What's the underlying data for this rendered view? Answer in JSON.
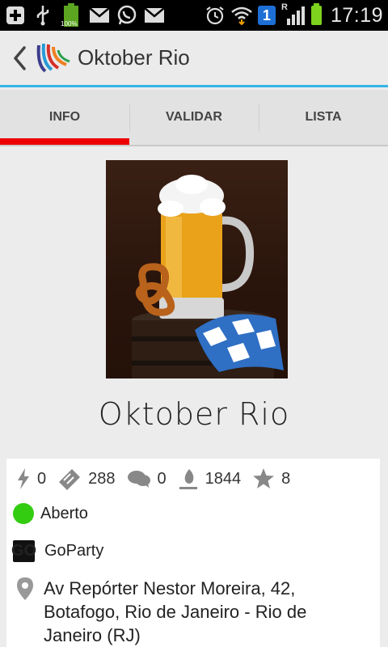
{
  "status_bar": {
    "time": "17:19",
    "battery_label": "100%",
    "network_badge": "1",
    "roaming": "R",
    "icons": [
      "add-icon",
      "usb-icon",
      "battery-full-icon",
      "gmail-icon",
      "whatsapp-icon",
      "gmail-icon",
      "alarm-icon",
      "wifi-icon",
      "network-badge-icon",
      "signal-icon",
      "battery-icon"
    ]
  },
  "action_bar": {
    "title": "Oktober Rio",
    "back_icon": "chevron-left-icon",
    "logo_icon": "app-logo-icon"
  },
  "tabs": [
    {
      "label": "INFO",
      "active": true
    },
    {
      "label": "VALIDAR",
      "active": false
    },
    {
      "label": "LISTA",
      "active": false
    }
  ],
  "event": {
    "name": "Oktober Rio",
    "image": "beer-mug-pretzel-image"
  },
  "stats": [
    {
      "icon": "lightning-icon",
      "value": "0"
    },
    {
      "icon": "ticket-icon",
      "value": "288"
    },
    {
      "icon": "comments-icon",
      "value": "0"
    },
    {
      "icon": "flame-icon",
      "value": "1844"
    },
    {
      "icon": "star-icon",
      "value": "8"
    }
  ],
  "status": {
    "label": "Aberto",
    "color": "#33cc11"
  },
  "organizer": {
    "name": "GoParty",
    "logo_text": "GO"
  },
  "address": "Av Repórter Nestor Moreira, 42, Botafogo, Rio de Janeiro - Rio de Janeiro (RJ)",
  "colors": {
    "accent": "#33b5e5",
    "tab_indicator": "#ee0000",
    "status_open": "#33cc11"
  }
}
